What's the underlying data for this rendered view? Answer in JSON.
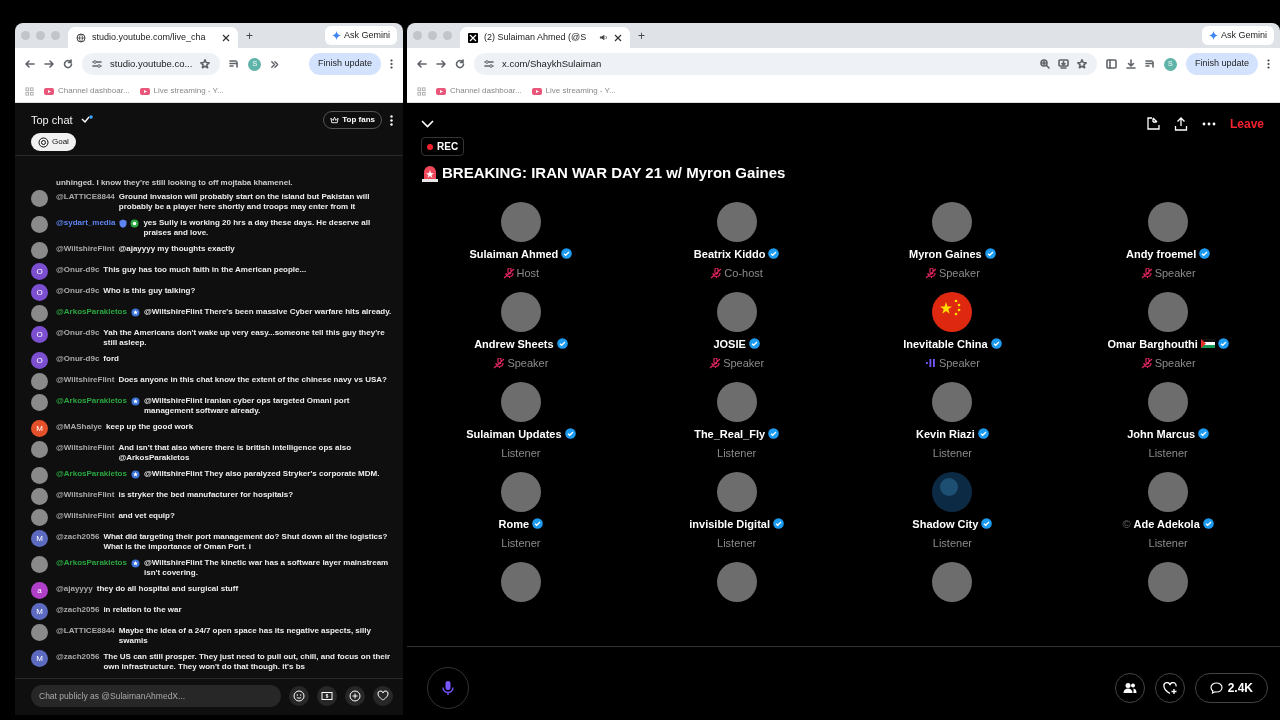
{
  "left_window": {
    "tab_title": "studio.youtube.com/live_cha",
    "new_tab": "+",
    "ask_gemini": "Ask Gemini",
    "address": "studio.youtube.co...",
    "profile_letter": "S",
    "finish_update": "Finish update",
    "bookmarks": [
      "Channel dashboar...",
      "Live streaming - Y..."
    ]
  },
  "live_chat": {
    "title": "Top chat",
    "top_fans": "Top fans",
    "goal": "Goal",
    "messages": [
      {
        "kind": "continuation",
        "text": "unhinged. I know they're still looking to off mojtaba khamenei."
      },
      {
        "kind": "message",
        "author": "@LATTICE8844",
        "moderator": false,
        "member": false,
        "avatar": {
          "kind": "photo"
        },
        "text": "Ground invasion will probably start on the island but Pakistan will probably be a player here shortly and troops may enter from it"
      },
      {
        "kind": "message",
        "author": "@sydart_media",
        "moderator": true,
        "member": true,
        "avatar": {
          "kind": "photo"
        },
        "text": "yes Sully is working 20 hrs a day these days. He deserve all praises and love."
      },
      {
        "kind": "message",
        "author": "@WiltshireFlint",
        "moderator": false,
        "member": false,
        "avatar": {
          "kind": "photo"
        },
        "text": "@ajayyyy my thoughts exactly"
      },
      {
        "kind": "message",
        "author": "@Onur-d9c",
        "moderator": false,
        "member": false,
        "avatar": {
          "kind": "letter",
          "letter": "O",
          "color": "#7b4fd0"
        },
        "text": "This guy has too much faith in the American people..."
      },
      {
        "kind": "message",
        "author": "@Onur-d9c",
        "moderator": false,
        "member": false,
        "avatar": {
          "kind": "letter",
          "letter": "O",
          "color": "#7b4fd0"
        },
        "text": "Who is this guy talking?"
      },
      {
        "kind": "message",
        "author": "@ArkosParakletos",
        "moderator": false,
        "member": true,
        "avatar": {
          "kind": "photo"
        },
        "text": "@WiltshireFlint There's been massive Cyber warfare hits already."
      },
      {
        "kind": "message",
        "author": "@Onur-d9c",
        "moderator": false,
        "member": false,
        "avatar": {
          "kind": "letter",
          "letter": "O",
          "color": "#7b4fd0"
        },
        "text": "Yah the Americans don't wake up very easy...someone tell this guy they're still asleep."
      },
      {
        "kind": "message",
        "author": "@Onur-d9c",
        "moderator": false,
        "member": false,
        "avatar": {
          "kind": "letter",
          "letter": "O",
          "color": "#7b4fd0"
        },
        "text": "ford"
      },
      {
        "kind": "message",
        "author": "@WiltshireFlint",
        "moderator": false,
        "member": false,
        "avatar": {
          "kind": "photo"
        },
        "text": "Does anyone in this chat know the extent of the chinese navy vs USA?"
      },
      {
        "kind": "message",
        "author": "@ArkosParakletos",
        "moderator": false,
        "member": true,
        "avatar": {
          "kind": "photo"
        },
        "text": "@WiltshireFlint Iranian cyber ops targeted Omani port management software already."
      },
      {
        "kind": "message",
        "author": "@MAShaiye",
        "moderator": false,
        "member": false,
        "avatar": {
          "kind": "letter",
          "letter": "M",
          "color": "#e4502a"
        },
        "text": "keep up the good work"
      },
      {
        "kind": "message",
        "author": "@WiltshireFlint",
        "moderator": false,
        "member": false,
        "avatar": {
          "kind": "photo"
        },
        "text": "And isn't that also where there is british intelligence ops also @ArkosParakletos"
      },
      {
        "kind": "message",
        "author": "@ArkosParakletos",
        "moderator": false,
        "member": true,
        "avatar": {
          "kind": "photo"
        },
        "text": "@WiltshireFlint They also paralyzed Stryker's corporate MDM."
      },
      {
        "kind": "message",
        "author": "@WiltshireFlint",
        "moderator": false,
        "member": false,
        "avatar": {
          "kind": "photo"
        },
        "text": "is stryker the bed manufacturer for hospitals?"
      },
      {
        "kind": "message",
        "author": "@WiltshireFlint",
        "moderator": false,
        "member": false,
        "avatar": {
          "kind": "photo"
        },
        "text": "and vet equip?"
      },
      {
        "kind": "message",
        "author": "@zach2056",
        "moderator": false,
        "member": false,
        "avatar": {
          "kind": "letter",
          "letter": "M",
          "color": "#5c6bc0"
        },
        "text": "What did targeting their port management do? Shut down all the logistics? What is the importance of Oman Port. i"
      },
      {
        "kind": "message",
        "author": "@ArkosParakletos",
        "moderator": false,
        "member": true,
        "avatar": {
          "kind": "photo"
        },
        "text": "@WiltshireFlint The kinetic war has a software layer mainstream isn't covering."
      },
      {
        "kind": "message",
        "author": "@ajayyyy",
        "moderator": false,
        "member": false,
        "avatar": {
          "kind": "letter",
          "letter": "a",
          "color": "#b040c8"
        },
        "text": "they do all hospital and surgical stuff"
      },
      {
        "kind": "message",
        "author": "@zach2056",
        "moderator": false,
        "member": false,
        "avatar": {
          "kind": "letter",
          "letter": "M",
          "color": "#5c6bc0"
        },
        "text": "in relation to the war"
      },
      {
        "kind": "message",
        "author": "@LATTICE8844",
        "moderator": false,
        "member": false,
        "avatar": {
          "kind": "photo"
        },
        "text": "Maybe the idea of a 24/7 open space has its negative aspects, silly swamis"
      },
      {
        "kind": "message",
        "author": "@zach2056",
        "moderator": false,
        "member": false,
        "avatar": {
          "kind": "letter",
          "letter": "M",
          "color": "#5c6bc0"
        },
        "text": "The US can still prosper. They just need to pull out, chill, and focus on their own infrastructure. They won't do that though. it's bs"
      }
    ],
    "input_placeholder": "Chat publicly as @SulaimanAhmedX..."
  },
  "right_window": {
    "tab_title": "(2) Sulaiman Ahmed (@S",
    "new_tab": "+",
    "ask_gemini": "Ask Gemini",
    "address": "x.com/ShaykhSulaiman",
    "profile_letter": "S",
    "finish_update": "Finish update",
    "bookmarks": [
      "Channel dashboar...",
      "Live streaming - Y..."
    ]
  },
  "space": {
    "leave": "Leave",
    "rec": "REC",
    "title": "BREAKING: IRAN WAR DAY 21 w/ Myron Gaines",
    "participants": [
      {
        "kind": "photo",
        "name": "Sulaiman Ahmed",
        "verified": true,
        "role": "Host",
        "muted": true,
        "speaking": false
      },
      {
        "kind": "photo",
        "name": "Beatrix Kiddo",
        "verified": true,
        "role": "Co-host",
        "muted": true,
        "speaking": false
      },
      {
        "kind": "photo",
        "name": "Myron Gaines",
        "verified": true,
        "role": "Speaker",
        "muted": true,
        "speaking": false
      },
      {
        "kind": "photo",
        "name": "Andy froemel",
        "verified": true,
        "role": "Speaker",
        "muted": true,
        "speaking": false
      },
      {
        "kind": "photo",
        "name": "Andrew Sheets",
        "verified": true,
        "role": "Speaker",
        "muted": true,
        "speaking": false
      },
      {
        "kind": "photo",
        "name": "JOSIE",
        "verified": true,
        "role": "Speaker",
        "muted": true,
        "speaking": false
      },
      {
        "kind": "flag",
        "name": "Inevitable China",
        "verified": true,
        "role": "Speaker",
        "muted": false,
        "speaking": true
      },
      {
        "kind": "photo",
        "name": "Omar Barghouthi",
        "name_flag": true,
        "verified": true,
        "role": "Speaker",
        "muted": true,
        "speaking": false
      },
      {
        "kind": "photo",
        "name": "Sulaiman Updates",
        "verified": true,
        "role": "Listener",
        "muted": false,
        "speaking": false
      },
      {
        "kind": "photo",
        "name": "The_Real_Fly",
        "verified": true,
        "role": "Listener",
        "muted": false,
        "speaking": false
      },
      {
        "kind": "photo",
        "name": "Kevin Riazi",
        "verified": true,
        "role": "Listener",
        "muted": false,
        "speaking": false
      },
      {
        "kind": "photo",
        "name": "John Marcus",
        "verified": true,
        "role": "Listener",
        "muted": false,
        "speaking": false
      },
      {
        "kind": "photo",
        "name": "Rome",
        "verified": true,
        "role": "Listener",
        "muted": false,
        "speaking": false
      },
      {
        "kind": "photo",
        "name": "invisible Digital",
        "verified": true,
        "role": "Listener",
        "muted": false,
        "speaking": false
      },
      {
        "kind": "globe",
        "name": "Shadow City",
        "verified": true,
        "role": "Listener",
        "muted": false,
        "speaking": false
      },
      {
        "kind": "photo",
        "name_prefix": "©",
        "name": "Ade Adekola",
        "verified": true,
        "role": "Listener",
        "muted": false,
        "speaking": false
      },
      {
        "kind": "photo"
      },
      {
        "kind": "photo"
      },
      {
        "kind": "photo"
      },
      {
        "kind": "photo"
      }
    ],
    "comments_count": "2.4K"
  }
}
